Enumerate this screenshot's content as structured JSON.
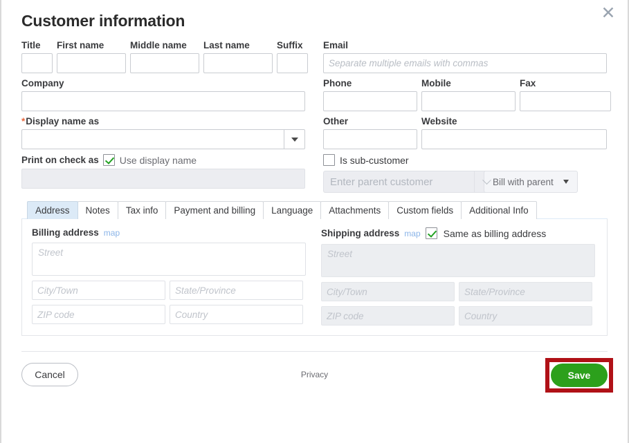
{
  "header": {
    "title": "Customer information",
    "close_icon": "close-icon"
  },
  "name_fields": [
    {
      "label": "Title",
      "value": "",
      "placeholder": ""
    },
    {
      "label": "First name",
      "value": "",
      "placeholder": ""
    },
    {
      "label": "Middle name",
      "value": "",
      "placeholder": ""
    },
    {
      "label": "Last name",
      "value": "",
      "placeholder": ""
    },
    {
      "label": "Suffix",
      "value": "",
      "placeholder": ""
    }
  ],
  "company": {
    "label": "Company",
    "value": "",
    "placeholder": ""
  },
  "display_name": {
    "required_marker": "*",
    "label": "Display name as",
    "value": "",
    "placeholder": "",
    "dropdown_icon": "chevron-down-icon"
  },
  "print_on_check": {
    "label": "Print on check as",
    "checkbox_label": "Use display name",
    "checked": true,
    "value": "",
    "placeholder": "",
    "disabled": true
  },
  "email": {
    "label": "Email",
    "value": "",
    "placeholder": "Separate multiple emails with commas"
  },
  "phone": {
    "label": "Phone",
    "value": "",
    "placeholder": ""
  },
  "mobile": {
    "label": "Mobile",
    "value": "",
    "placeholder": ""
  },
  "fax": {
    "label": "Fax",
    "value": "",
    "placeholder": ""
  },
  "other": {
    "label": "Other",
    "value": "",
    "placeholder": ""
  },
  "website": {
    "label": "Website",
    "value": "",
    "placeholder": ""
  },
  "sub_customer": {
    "checkbox_label": "Is sub-customer",
    "checked": false,
    "parent_placeholder": "Enter parent customer",
    "parent_value": "",
    "parent_dropdown_icon": "chevron-down-icon",
    "bill_option": "Bill with parent",
    "bill_dropdown_icon": "chevron-down-icon"
  },
  "tabs": [
    {
      "label": "Address",
      "active": true
    },
    {
      "label": "Notes",
      "active": false
    },
    {
      "label": "Tax info",
      "active": false
    },
    {
      "label": "Payment and billing",
      "active": false
    },
    {
      "label": "Language",
      "active": false
    },
    {
      "label": "Attachments",
      "active": false
    },
    {
      "label": "Custom fields",
      "active": false
    },
    {
      "label": "Additional Info",
      "active": false
    }
  ],
  "billing_address": {
    "title": "Billing address",
    "map_link": "map",
    "street_placeholder": "Street",
    "street_value": "",
    "city_placeholder": "City/Town",
    "city_value": "",
    "state_placeholder": "State/Province",
    "state_value": "",
    "zip_placeholder": "ZIP code",
    "zip_value": "",
    "country_placeholder": "Country",
    "country_value": ""
  },
  "shipping_address": {
    "title": "Shipping address",
    "map_link": "map",
    "same_as_billing_label": "Same as billing address",
    "same_as_billing_checked": true,
    "street_placeholder": "Street",
    "street_value": "",
    "city_placeholder": "City/Town",
    "city_value": "",
    "state_placeholder": "State/Province",
    "state_value": "",
    "zip_placeholder": "ZIP code",
    "zip_value": "",
    "country_placeholder": "Country",
    "country_value": ""
  },
  "footer": {
    "cancel_label": "Cancel",
    "privacy_label": "Privacy",
    "save_label": "Save"
  },
  "colors": {
    "save_green": "#2ca01c",
    "highlight_red": "#b01117",
    "required_orange": "#e8683f",
    "active_tab_blue": "#dceaf7",
    "map_link_blue": "#8ab4e8",
    "disabled_gray": "#eceef1"
  }
}
